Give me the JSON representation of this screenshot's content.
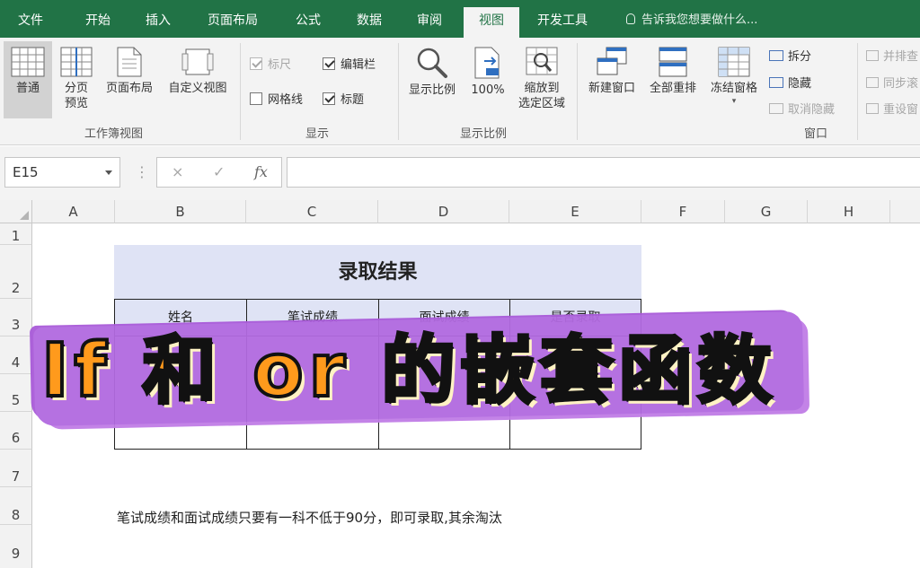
{
  "tabs": [
    "文件",
    "开始",
    "插入",
    "页面布局",
    "公式",
    "数据",
    "审阅",
    "视图",
    "开发工具"
  ],
  "active_tab": "视图",
  "tell_me": "告诉我您想要做什么...",
  "ribbon": {
    "workbook_views": {
      "label": "工作簿视图",
      "buttons": [
        "普通",
        "分页\n预览",
        "页面布局",
        "自定义视图"
      ]
    },
    "show": {
      "label": "显示",
      "ruler": "标尺",
      "formula_bar": "编辑栏",
      "gridlines": "网格线",
      "headings": "标题",
      "ruler_checked": true,
      "formula_bar_checked": true,
      "gridlines_checked": false,
      "headings_checked": true
    },
    "zoom": {
      "label": "显示比例",
      "zoom": "显示比例",
      "hundred": "100%",
      "zoom_selection": "缩放到\n选定区域"
    },
    "window": {
      "label": "窗口",
      "new_window": "新建窗口",
      "arrange_all": "全部重排",
      "freeze_panes": "冻结窗格",
      "split": "拆分",
      "hide": "隐藏",
      "unhide": "取消隐藏",
      "view_side_by_side": "并排查",
      "sync_scroll": "同步滚",
      "reset_position": "重设窗"
    }
  },
  "formula_bar": {
    "name_box": "E15",
    "cancel": "×",
    "enter": "✓",
    "fx": "fx",
    "content": ""
  },
  "columns": [
    "A",
    "B",
    "C",
    "D",
    "E",
    "F",
    "G",
    "H"
  ],
  "rows": [
    "1",
    "2",
    "3",
    "4",
    "5",
    "6",
    "7",
    "8",
    "9"
  ],
  "sheet": {
    "table_title": "录取结果",
    "headers": [
      "姓名",
      "笔试成绩",
      "面试成绩",
      "是否录取"
    ],
    "note": "笔试成绩和面试成绩只要有一科不低于90分，即可录取,其余淘汰"
  },
  "overlay_caption": "If 和 or 的嵌套函数",
  "colors": {
    "excel_green": "#217346",
    "table_header_fill": "#dfe3f5",
    "caption_fill": "#ff9a1c",
    "brush_purple": "#b26ae0"
  }
}
